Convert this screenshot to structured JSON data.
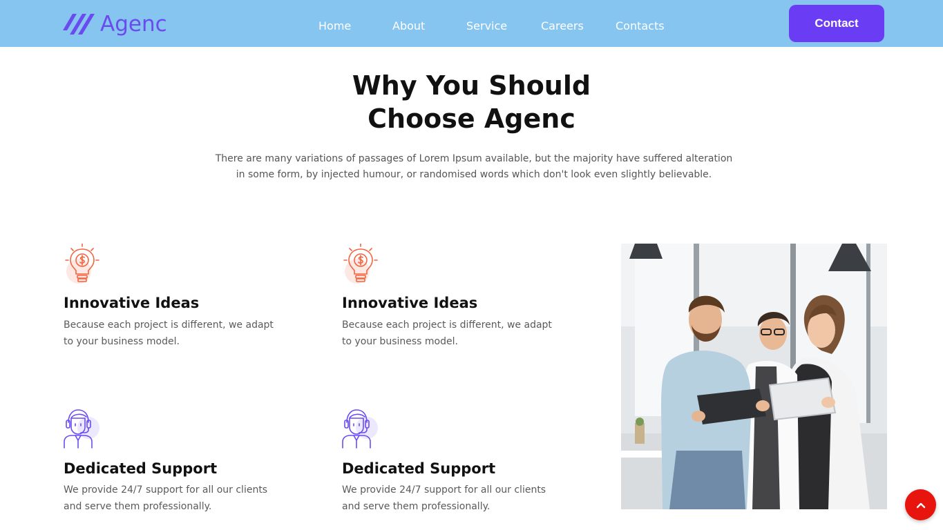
{
  "brand": {
    "name": "Agenc",
    "accent": "#6a3df4",
    "header_bg": "#86c5f0"
  },
  "nav": {
    "items": [
      {
        "label": "Home"
      },
      {
        "label": "About"
      },
      {
        "label": "Service"
      },
      {
        "label": "Careers"
      },
      {
        "label": "Contacts"
      }
    ],
    "cta_label": "Contact"
  },
  "section": {
    "title_line1": "Why You Should",
    "title_line2": "Choose Agenc",
    "description_line1": "There are many variations of passages of Lorem Ipsum available, but the majority have suffered alteration",
    "description_line2": "in some form, by injected humour, or randomised words which don't look even slightly believable."
  },
  "features": [
    {
      "icon": "lightbulb-dollar-icon",
      "title": "Innovative Ideas",
      "description": "Because each project is different, we adapt to your business model."
    },
    {
      "icon": "lightbulb-dollar-icon",
      "title": "Innovative Ideas",
      "description": "Because each project is different, we adapt to your business model."
    },
    {
      "icon": "support-agent-icon",
      "title": "Dedicated Support",
      "description": "We provide 24/7 support for all our clients and serve them professionally."
    },
    {
      "icon": "support-agent-icon",
      "title": "Dedicated Support",
      "description": "We provide 24/7 support for all our clients and serve them professionally."
    }
  ],
  "photo": {
    "icon": "team-photo"
  },
  "scroll_top": {
    "icon": "chevron-up-icon",
    "color": "#e8150f"
  }
}
